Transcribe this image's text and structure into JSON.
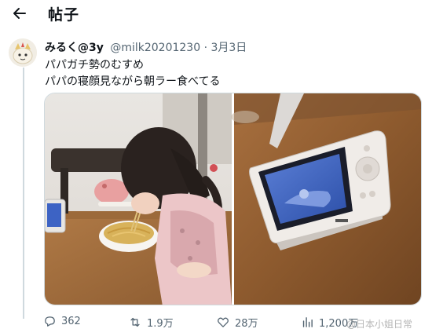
{
  "header": {
    "title": "帖子",
    "back_icon": "arrow-left-icon"
  },
  "post": {
    "author_name": "みるく@3y",
    "handle": "@milk20201230",
    "separator": "·",
    "date": "3月3日",
    "text_lines": [
      "パパガチ勢のむすめ",
      "パパの寝顔見ながら朝ラー食べてる"
    ],
    "media_count": 2
  },
  "actions": {
    "replies": "362",
    "reposts": "1.9万",
    "likes": "28万",
    "views": "1,200万"
  },
  "watermark": {
    "text": "@日本小姐日常"
  },
  "colors": {
    "text": "#0f1419",
    "secondary": "#536471",
    "border": "#cfd9de"
  }
}
